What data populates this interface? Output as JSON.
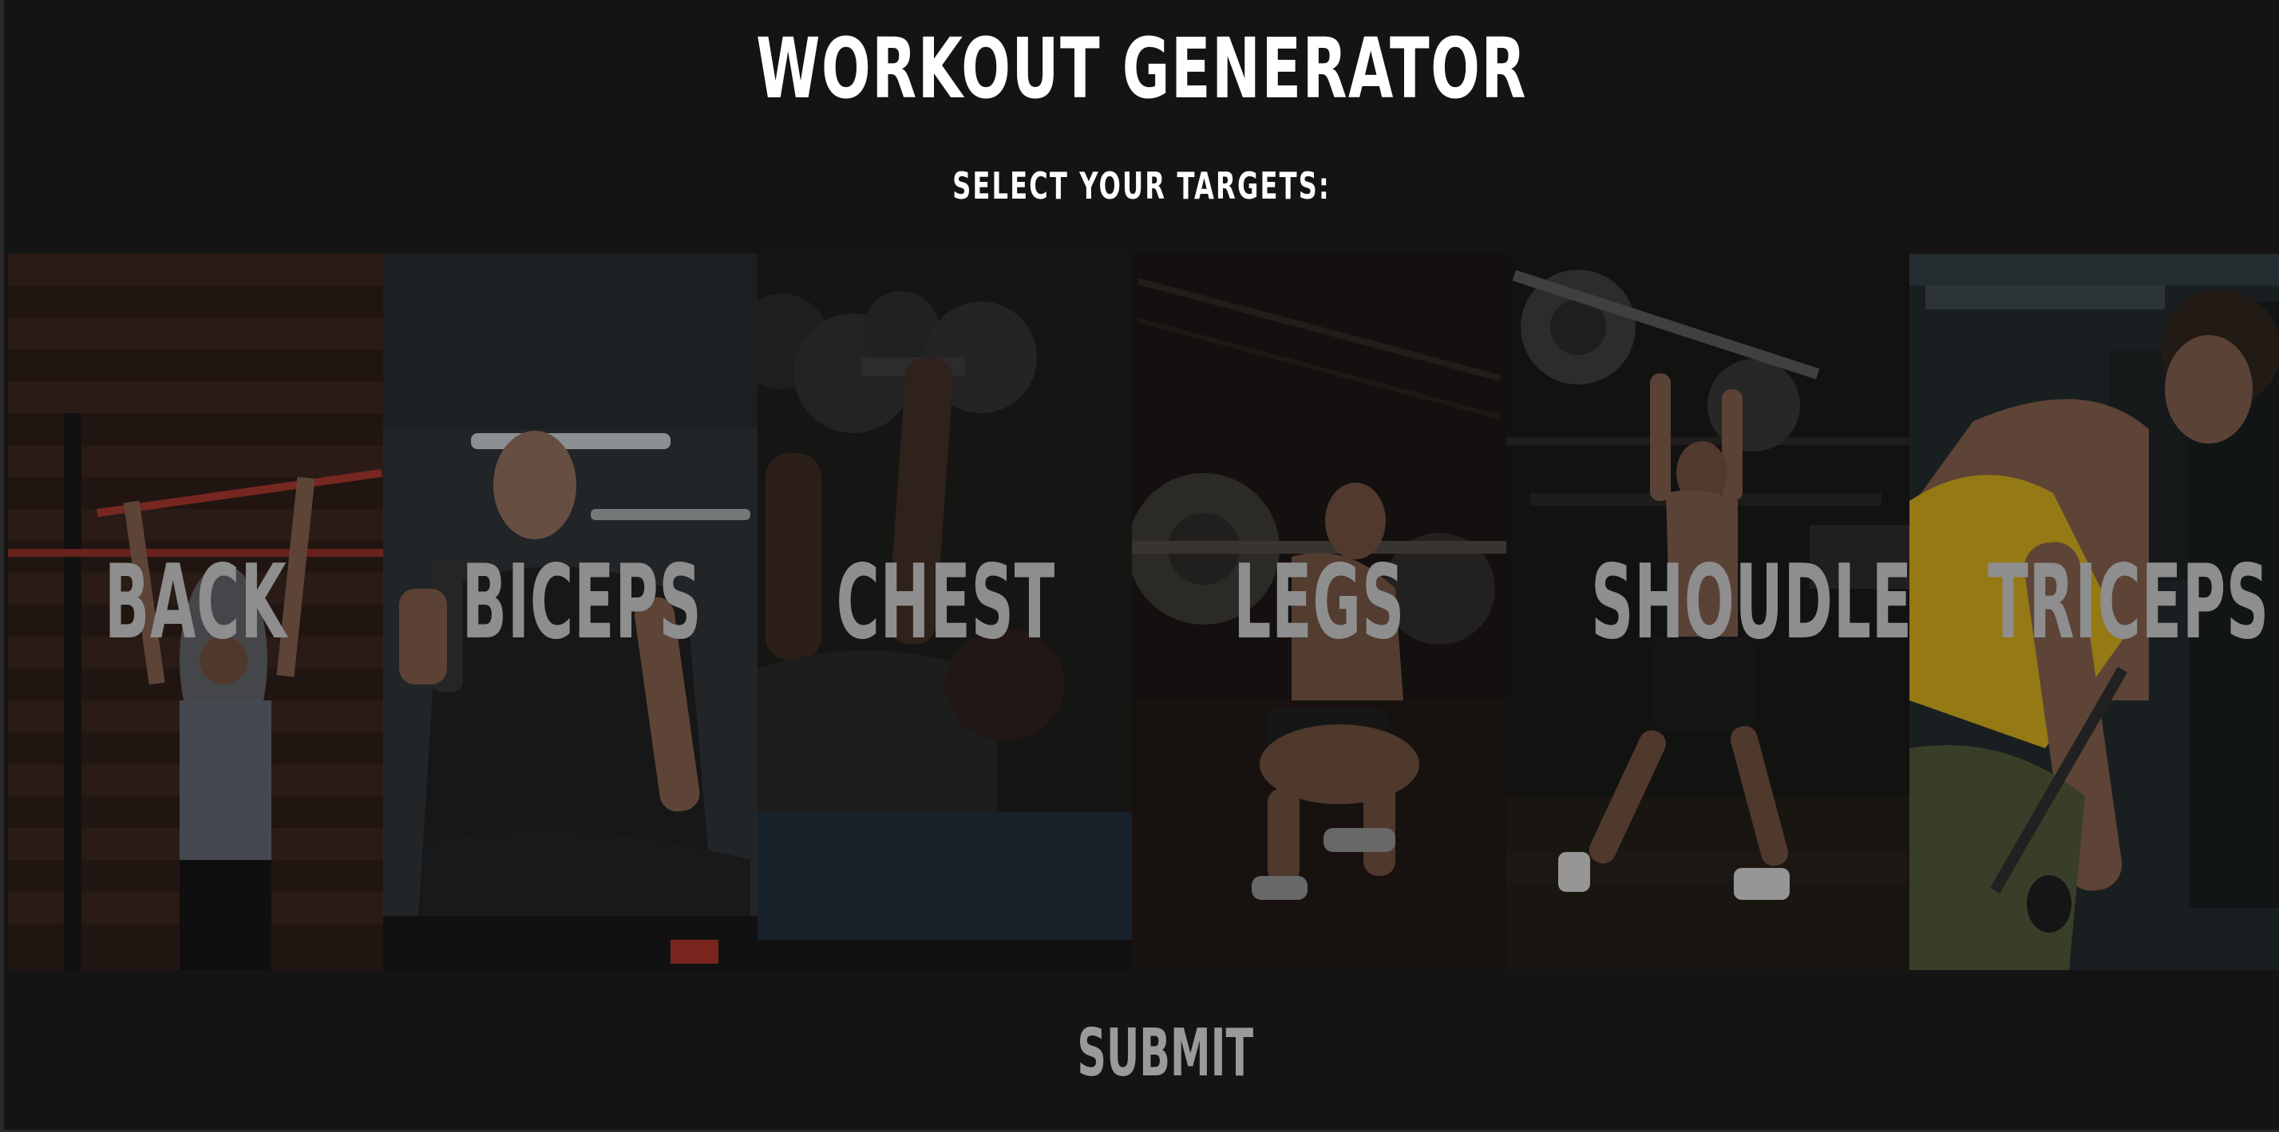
{
  "header": {
    "title": "WORKOUT GENERATOR",
    "subtitle": "SELECT YOUR TARGETS:"
  },
  "targets": [
    {
      "id": "back",
      "label": "BACK"
    },
    {
      "id": "biceps",
      "label": "BICEPS"
    },
    {
      "id": "chest",
      "label": "CHEST"
    },
    {
      "id": "legs",
      "label": "LEGS"
    },
    {
      "id": "shoulders",
      "label": "SHOUDLERS"
    },
    {
      "id": "triceps",
      "label": "TRICEPS"
    }
  ],
  "actions": {
    "submit_label": "SUBMIT"
  },
  "colors": {
    "background": "#141414",
    "title_text": "#ffffff",
    "tile_label": "#8e8e8e",
    "submit_text": "#9a9a9a",
    "triceps_tank_top": "#c9a418"
  }
}
